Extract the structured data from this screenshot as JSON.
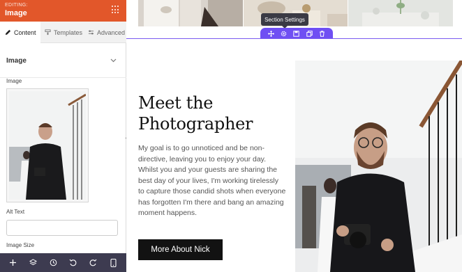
{
  "panel": {
    "editing_label": "EDITING:",
    "title": "Image",
    "tabs": [
      {
        "label": "Content"
      },
      {
        "label": "Templates"
      },
      {
        "label": "Advanced"
      }
    ],
    "section_title": "Image",
    "image_label": "Image",
    "alt_text_label": "Alt Text",
    "alt_text_value": "",
    "image_size_label": "Image Size"
  },
  "canvas": {
    "section_tooltip": "Section Settings",
    "heading_line1": "Meet the",
    "heading_line2": "Photographer",
    "paragraph": "My goal is to go unnoticed and be non-directive, leaving you to enjoy your day. Whilst you and your guests are sharing the best day of your lives, I'm working tirelessly to capture those candid shots when everyone has forgotten I'm there and bang an amazing moment happens.",
    "cta_label": "More About Nick"
  },
  "colors": {
    "header_orange": "#e2572a",
    "section_purple": "#6f4ff3",
    "footer_dark": "#3d3b50",
    "button_black": "#121212"
  },
  "icons": {
    "header": "grip-dots-icon",
    "footer": [
      "plus-icon",
      "layers-icon",
      "history-icon",
      "undo-icon",
      "redo-icon",
      "mobile-icon"
    ],
    "section_bar": [
      "move-icon",
      "settings-icon",
      "save-icon",
      "duplicate-icon",
      "delete-icon"
    ]
  }
}
